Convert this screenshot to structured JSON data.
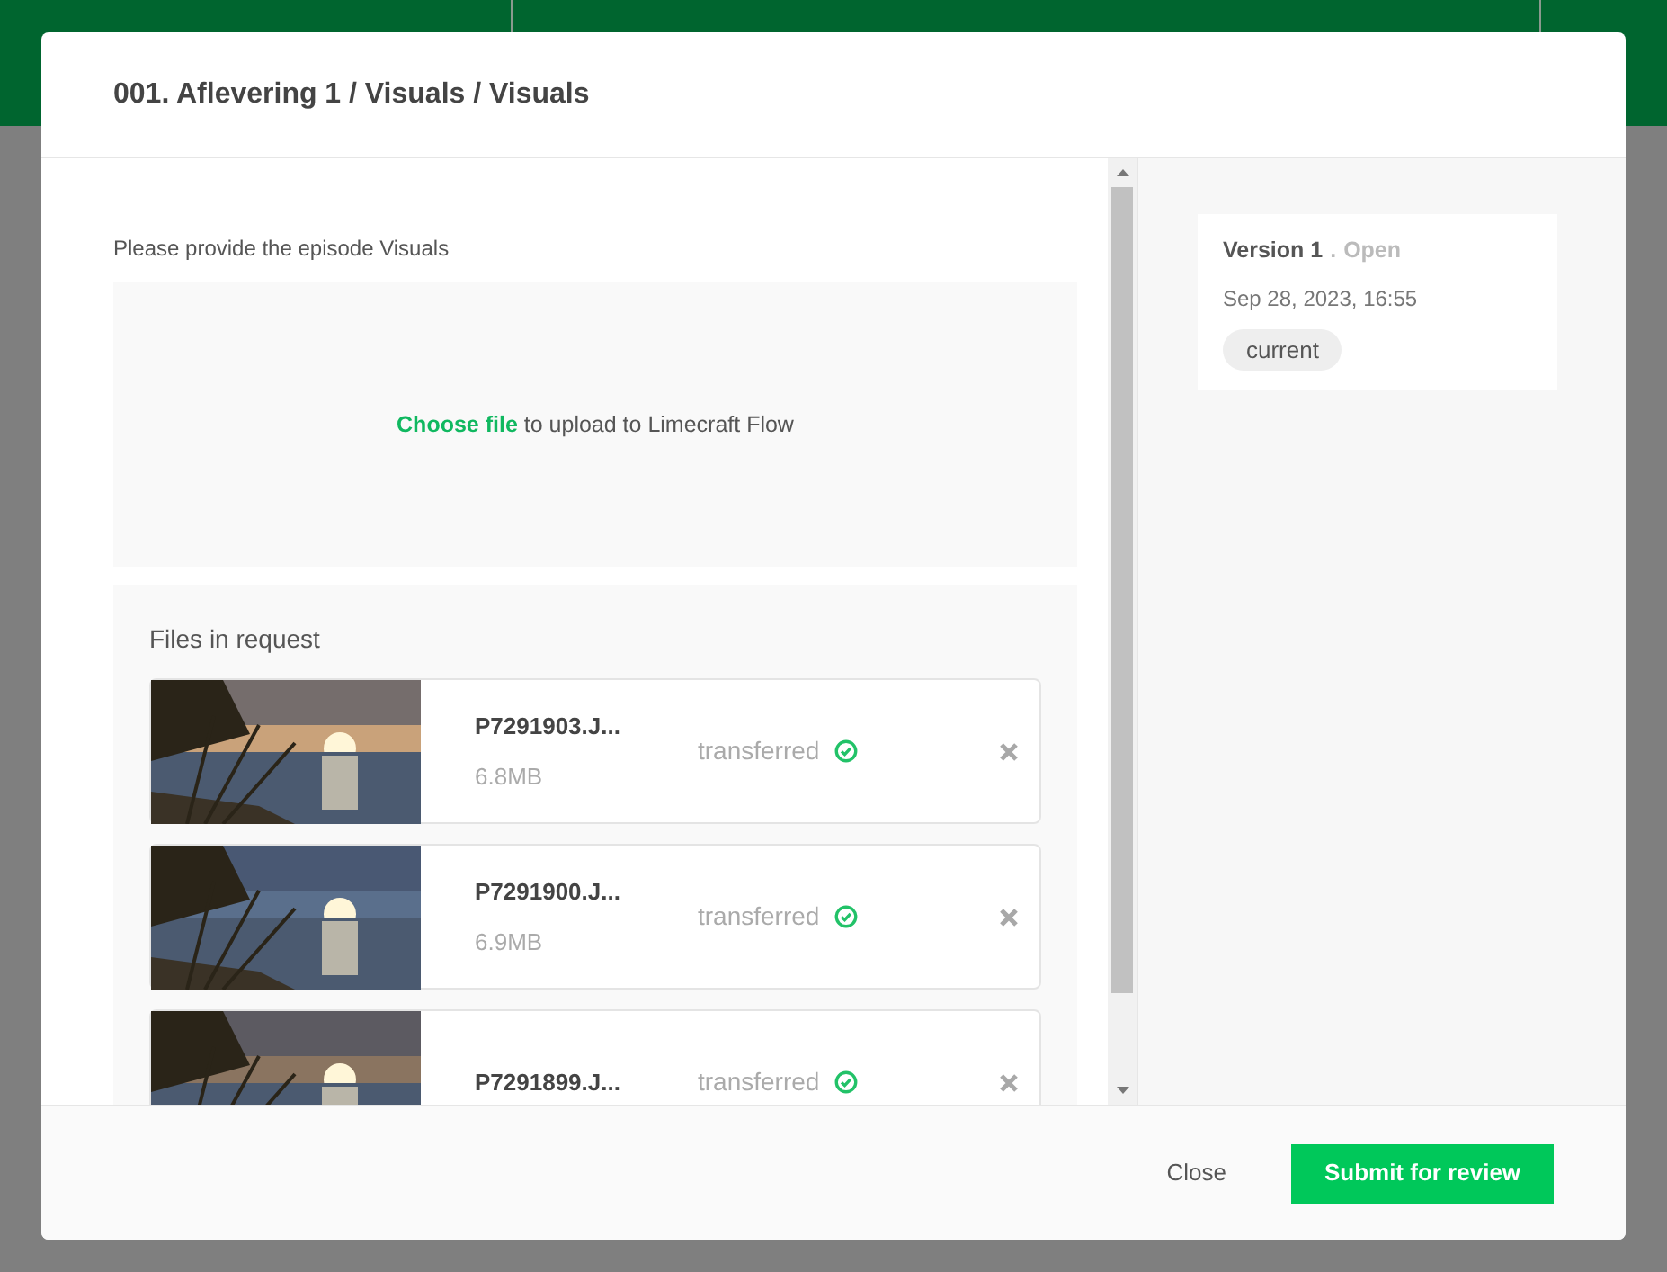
{
  "dialog": {
    "title": "001. Aflevering 1 / Visuals / Visuals"
  },
  "upload": {
    "prompt": "Please provide the episode Visuals",
    "link": "Choose file",
    "text": "to upload to Limecraft Flow"
  },
  "files_section": {
    "title": "Files in request",
    "files": [
      {
        "name": "P7291903.J...",
        "size": "6.8MB",
        "status": "transferred",
        "kind": "picture"
      },
      {
        "name": "P7291900.J...",
        "size": "6.9MB",
        "status": "transferred",
        "kind": "picture"
      },
      {
        "name": "P7291899.J...",
        "status": "transferred",
        "kind": "picture"
      }
    ]
  },
  "version": {
    "title": "Version 1",
    "separator": ".",
    "state": "Open",
    "date": "Sep 28, 2023, 16:55",
    "badge": "current"
  },
  "footer": {
    "close": "Close",
    "submit": "Submit for review"
  }
}
